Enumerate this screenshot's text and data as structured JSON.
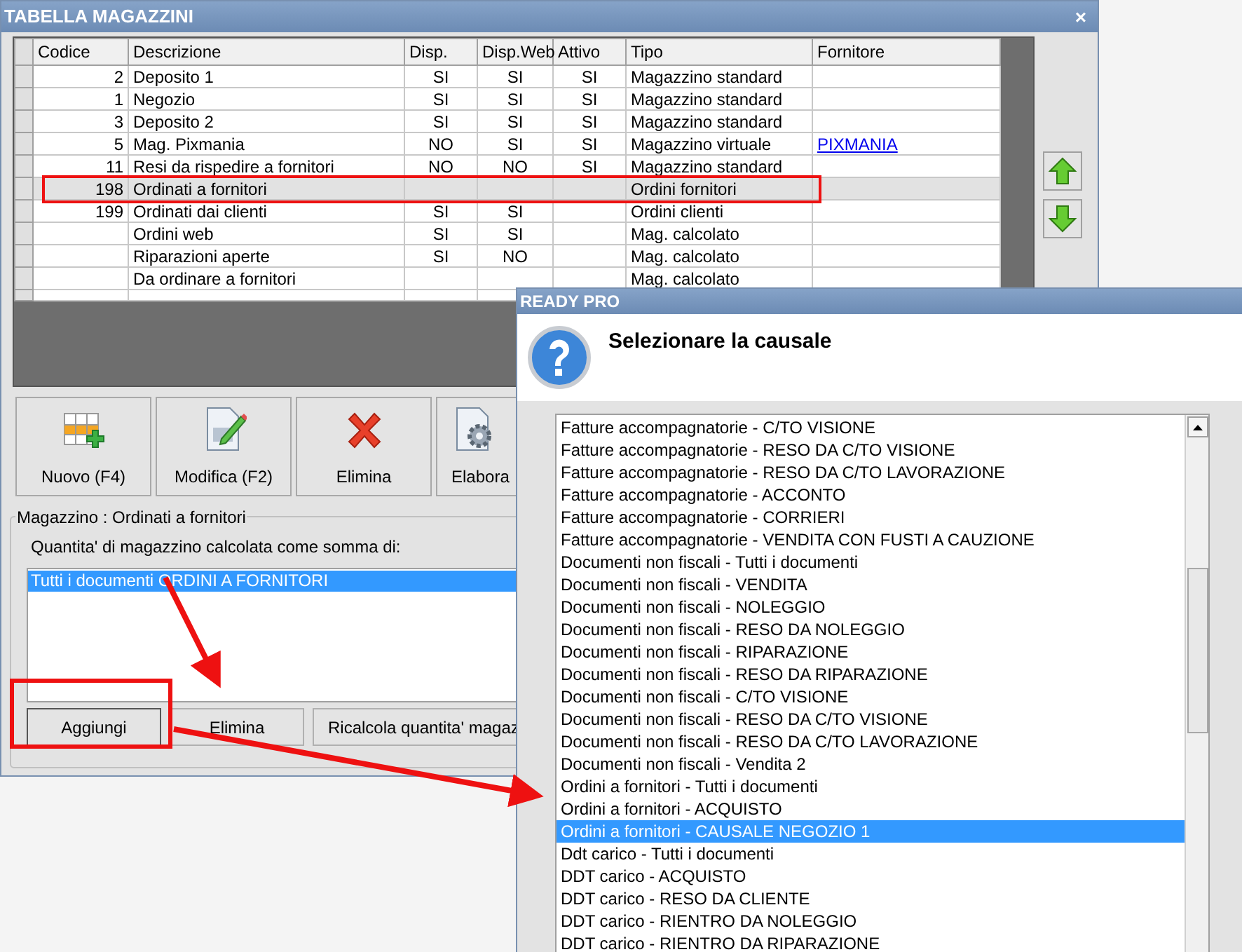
{
  "window": {
    "title": "TABELLA MAGAZZINI",
    "close": "×"
  },
  "table": {
    "columns": [
      "Codice",
      "Descrizione",
      "Disp.",
      "Disp.Web",
      "Attivo",
      "Tipo",
      "Fornitore"
    ],
    "rows": [
      {
        "codice": "2",
        "descrizione": "Deposito 1",
        "disp": "SI",
        "disp_web": "SI",
        "attivo": "SI",
        "tipo": "Magazzino standard",
        "selected": false
      },
      {
        "codice": "1",
        "descrizione": "Negozio",
        "disp": "SI",
        "disp_web": "SI",
        "attivo": "SI",
        "tipo": "Magazzino standard",
        "selected": false
      },
      {
        "codice": "3",
        "descrizione": "Deposito 2",
        "disp": "SI",
        "disp_web": "SI",
        "attivo": "SI",
        "tipo": "Magazzino standard",
        "selected": false
      },
      {
        "codice": "5",
        "descrizione": "Mag. Pixmania",
        "disp": "NO",
        "disp_web": "SI",
        "attivo": "SI",
        "tipo": "Magazzino virtuale",
        "fornitore": "PIXMANIA",
        "selected": false
      },
      {
        "codice": "11",
        "descrizione": "Resi da rispedire a fornitori",
        "disp": "NO",
        "disp_web": "NO",
        "attivo": "SI",
        "tipo": "Magazzino standard",
        "selected": false
      },
      {
        "codice": "198",
        "descrizione": "Ordinati a fornitori",
        "tipo": "Ordini fornitori",
        "selected": true
      },
      {
        "codice": "199",
        "descrizione": "Ordinati dai clienti",
        "disp": "SI",
        "disp_web": "SI",
        "tipo": "Ordini clienti",
        "selected": false
      },
      {
        "descrizione": "Ordini web",
        "disp": "SI",
        "disp_web": "SI",
        "tipo": "Mag. calcolato",
        "selected": false
      },
      {
        "descrizione": "Riparazioni aperte",
        "disp": "SI",
        "disp_web": "NO",
        "tipo": "Mag. calcolato",
        "selected": false
      },
      {
        "descrizione": "Da ordinare a fornitori",
        "tipo": "Mag. calcolato",
        "selected": false
      }
    ]
  },
  "toolbar": [
    {
      "kind": "new",
      "label": "Nuovo (F4)"
    },
    {
      "kind": "edit",
      "label": "Modifica (F2)"
    },
    {
      "kind": "delete",
      "label": "Elimina"
    },
    {
      "kind": "process",
      "label": "Elabora"
    }
  ],
  "group": {
    "title": "Magazzino : Ordinati a fornitori",
    "label": "Quantita' di magazzino calcolata come somma di:",
    "items": [
      {
        "label": "Tutti i documenti ORDINI A FORNITORI",
        "selected": true
      }
    ],
    "buttons": [
      "Aggiungi",
      "Elimina",
      "Ricalcola quantita' magaz"
    ]
  },
  "dialog": {
    "title": "READY PRO",
    "message": "Selezionare la causale",
    "items": [
      {
        "label": "Fatture accompagnatorie - C/TO VISIONE",
        "selected": false
      },
      {
        "label": "Fatture accompagnatorie - RESO DA C/TO VISIONE",
        "selected": false
      },
      {
        "label": "Fatture accompagnatorie - RESO DA C/TO LAVORAZIONE",
        "selected": false
      },
      {
        "label": "Fatture accompagnatorie - ACCONTO",
        "selected": false
      },
      {
        "label": "Fatture accompagnatorie - CORRIERI",
        "selected": false
      },
      {
        "label": "Fatture accompagnatorie - VENDITA CON FUSTI A CAUZIONE",
        "selected": false
      },
      {
        "label": "Documenti non fiscali - Tutti i documenti",
        "selected": false
      },
      {
        "label": "Documenti non fiscali - VENDITA",
        "selected": false
      },
      {
        "label": "Documenti non fiscali - NOLEGGIO",
        "selected": false
      },
      {
        "label": "Documenti non fiscali - RESO DA NOLEGGIO",
        "selected": false
      },
      {
        "label": "Documenti non fiscali - RIPARAZIONE",
        "selected": false
      },
      {
        "label": "Documenti non fiscali - RESO DA RIPARAZIONE",
        "selected": false
      },
      {
        "label": "Documenti non fiscali - C/TO VISIONE",
        "selected": false
      },
      {
        "label": "Documenti non fiscali - RESO DA C/TO VISIONE",
        "selected": false
      },
      {
        "label": "Documenti non fiscali - RESO DA C/TO LAVORAZIONE",
        "selected": false
      },
      {
        "label": "Documenti non fiscali - Vendita 2",
        "selected": false
      },
      {
        "label": "Ordini a fornitori - Tutti i documenti",
        "selected": false
      },
      {
        "label": "Ordini a fornitori - ACQUISTO",
        "selected": false
      },
      {
        "label": "Ordini a fornitori - CAUSALE NEGOZIO 1",
        "selected": true
      },
      {
        "label": "Ddt carico - Tutti i documenti",
        "selected": false
      },
      {
        "label": "DDT carico - ACQUISTO",
        "selected": false
      },
      {
        "label": "DDT carico - RESO DA CLIENTE",
        "selected": false
      },
      {
        "label": "DDT carico - RIENTRO DA NOLEGGIO",
        "selected": false
      },
      {
        "label": "DDT carico - RIENTRO DA RIPARAZIONE",
        "selected": false
      }
    ]
  }
}
